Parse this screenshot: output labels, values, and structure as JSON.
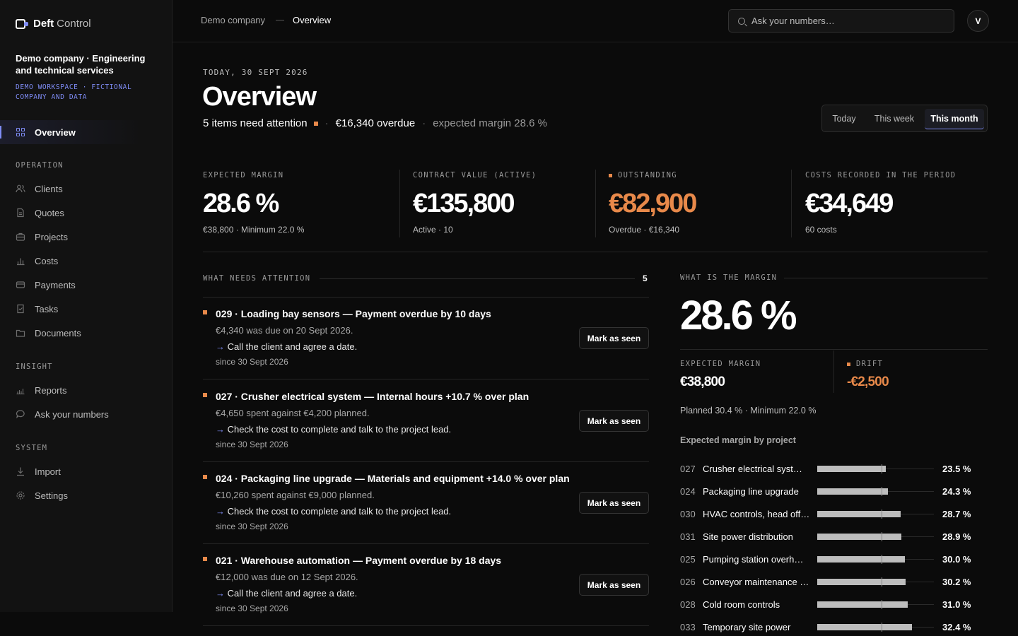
{
  "app": {
    "brand_a": "Deft",
    "brand_b": "Control"
  },
  "sidebar": {
    "company": "Demo company · Engineering and technical services",
    "workspace": "DEMO WORKSPACE · FICTIONAL COMPANY AND DATA",
    "overview": "Overview",
    "sections": {
      "operation": "OPERATION",
      "insight": "INSIGHT",
      "system": "SYSTEM"
    },
    "operation": [
      "Clients",
      "Quotes",
      "Projects",
      "Costs",
      "Payments",
      "Tasks",
      "Documents"
    ],
    "insight": [
      "Reports",
      "Ask your numbers"
    ],
    "system": [
      "Import",
      "Settings"
    ]
  },
  "topbar": {
    "breadcrumb_1": "Demo company",
    "breadcrumb_2": "Overview",
    "search_placeholder": "Ask your numbers…",
    "avatar_initial": "V"
  },
  "header": {
    "today": "TODAY, 30 SEPT 2026",
    "title": "Overview",
    "attention": "5 items need attention",
    "overdue": "€16,340 overdue",
    "expected": "expected margin 28.6 %"
  },
  "period": {
    "today": "Today",
    "week": "This week",
    "month": "This month",
    "selected": "This month"
  },
  "kpis": [
    {
      "label": "EXPECTED MARGIN",
      "value": "28.6 %",
      "sub": "€38,800 · Minimum 22.0 %"
    },
    {
      "label": "CONTRACT VALUE (ACTIVE)",
      "value": "€135,800",
      "sub": "Active · 10"
    },
    {
      "label": "OUTSTANDING",
      "value": "€82,900",
      "sub": "Overdue · €16,340"
    },
    {
      "label": "COSTS RECORDED IN THE PERIOD",
      "value": "€34,649",
      "sub": "60 costs"
    }
  ],
  "attention": {
    "heading": "WHAT NEEDS ATTENTION",
    "count": "5",
    "button_label": "Mark as seen",
    "items": [
      {
        "title": "029 · Loading bay sensors — Payment overdue by 10 days",
        "detail": "€4,340 was due on 20 Sept 2026.",
        "action": "Call the client and agree a date.",
        "since": "since 30 Sept 2026"
      },
      {
        "title": "027 · Crusher electrical system — Internal hours +10.7 % over plan",
        "detail": "€4,650 spent against €4,200 planned.",
        "action": "Check the cost to complete and talk to the project lead.",
        "since": "since 30 Sept 2026"
      },
      {
        "title": "024 · Packaging line upgrade — Materials and equipment +14.0 % over plan",
        "detail": "€10,260 spent against €9,000 planned.",
        "action": "Check the cost to complete and talk to the project lead.",
        "since": "since 30 Sept 2026"
      },
      {
        "title": "021 · Warehouse automation — Payment overdue by 18 days",
        "detail": "€12,000 was due on 12 Sept 2026.",
        "action": "Call the client and agree a date.",
        "since": "since 30 Sept 2026"
      }
    ]
  },
  "margin": {
    "heading": "WHAT IS THE MARGIN",
    "big": "28.6 %",
    "expected_label": "EXPECTED MARGIN",
    "expected_value": "€38,800",
    "drift_label": "DRIFT",
    "drift_value": "-€2,500",
    "planned": "Planned 30.4 % · Minimum 22.0 %",
    "by_project_label": "Expected margin by project",
    "projects": [
      {
        "num": "027",
        "name": "Crusher electrical syst…",
        "value": 23.5,
        "pct": "23.5 %"
      },
      {
        "num": "024",
        "name": "Packaging line upgrade",
        "value": 24.3,
        "pct": "24.3 %"
      },
      {
        "num": "030",
        "name": "HVAC controls, head off…",
        "value": 28.7,
        "pct": "28.7 %"
      },
      {
        "num": "031",
        "name": "Site power distribution",
        "value": 28.9,
        "pct": "28.9 %"
      },
      {
        "num": "025",
        "name": "Pumping station overh…",
        "value": 30.0,
        "pct": "30.0 %"
      },
      {
        "num": "026",
        "name": "Conveyor maintenance …",
        "value": 30.2,
        "pct": "30.2 %"
      },
      {
        "num": "028",
        "name": "Cold room controls",
        "value": 31.0,
        "pct": "31.0 %"
      },
      {
        "num": "033",
        "name": "Temporary site power",
        "value": 32.4,
        "pct": "32.4 %"
      }
    ]
  },
  "colors": {
    "accent": "#7f8cf5",
    "warning": "#e8894a",
    "background": "#0b0b0b",
    "sidebar": "#121212"
  },
  "icons": {
    "overview": "grid-icon",
    "clients": "users-icon",
    "quotes": "document-icon",
    "projects": "briefcase-icon",
    "costs": "bar-chart-icon",
    "payments": "card-icon",
    "tasks": "check-doc-icon",
    "documents": "folder-icon",
    "reports": "chart-icon",
    "ask": "chat-icon",
    "import": "download-icon",
    "settings": "gear-icon"
  }
}
